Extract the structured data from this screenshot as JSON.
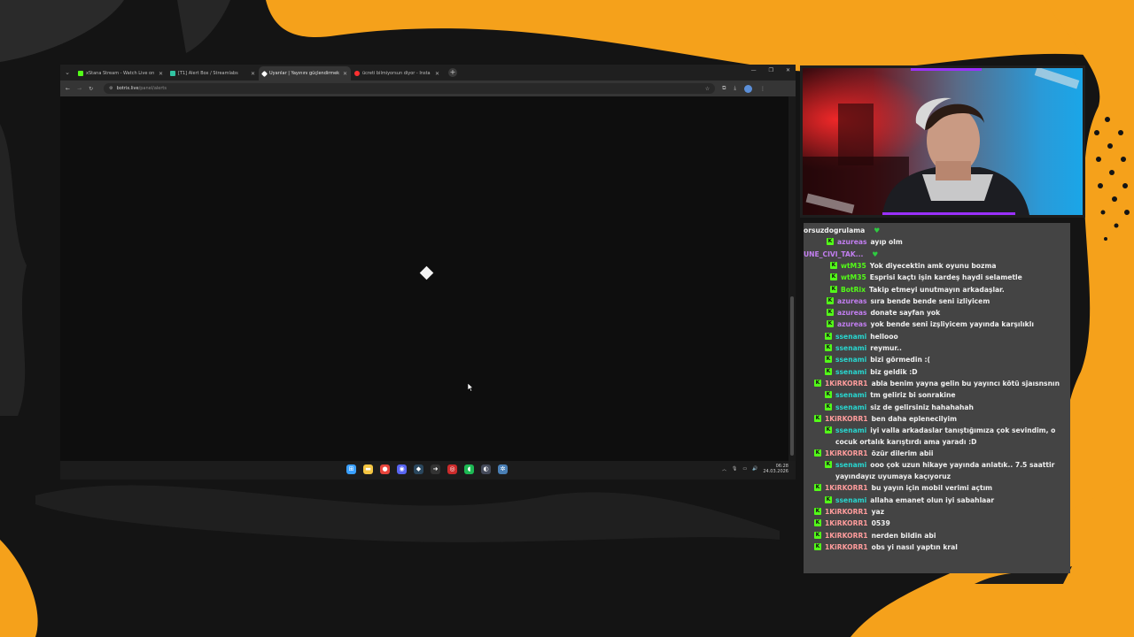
{
  "colors": {
    "background": "#141414",
    "accent_orange": "#f5a11b",
    "kick_green": "#53fc18",
    "webcam_accent": "#9b30ff",
    "chat_bg": "#444444"
  },
  "browser": {
    "tabs": [
      {
        "label": "xStana Stream - Watch Live on",
        "favicon": "kick-icon",
        "color": "#53fc18",
        "active": false
      },
      {
        "label": "[T1] Alert Box / Streamlabs",
        "favicon": "streamlabs-icon",
        "color": "#31c3a2",
        "active": false
      },
      {
        "label": "Uyarılar | Yayınını güçlendirmek",
        "favicon": "botrix-icon",
        "color": "#ffffff",
        "active": true
      },
      {
        "label": "ücreti bilmiyorsun diyor - İnsta",
        "favicon": "youtube-icon",
        "color": "#ff3030",
        "active": false
      }
    ],
    "new_tab_label": "+",
    "url_host": "botrix.live",
    "url_path": "/panel/alerts",
    "taskbar": {
      "time": "06:28",
      "date": "24.03.2026",
      "apps": [
        {
          "icon": "windows-start-icon",
          "color": "#3aa0ff",
          "glyph": "⊞"
        },
        {
          "icon": "file-explorer-icon",
          "color": "#f4c542",
          "glyph": "▬"
        },
        {
          "icon": "chrome-icon",
          "color": "#e8453c",
          "glyph": "●"
        },
        {
          "icon": "discord-icon",
          "color": "#5865f2",
          "glyph": "◉"
        },
        {
          "icon": "steam-icon",
          "color": "#2a475e",
          "glyph": "◆"
        },
        {
          "icon": "arrow-app-icon",
          "color": "#333333",
          "glyph": "➜"
        },
        {
          "icon": "record-icon",
          "color": "#cc2b2b",
          "glyph": "◎"
        },
        {
          "icon": "spotify-icon",
          "color": "#1db954",
          "glyph": "◖"
        },
        {
          "icon": "obs-icon",
          "color": "#444a5a",
          "glyph": "◐"
        },
        {
          "icon": "settings-app-icon",
          "color": "#4a7fb5",
          "glyph": "✲"
        }
      ]
    }
  },
  "chat": {
    "messages": [
      {
        "user": "orsuzdogrulama",
        "user_color": "#f0f0f0",
        "text": "",
        "heart": true,
        "badge": false,
        "indent": 0
      },
      {
        "user": "azureas",
        "user_color": "#c27ef0",
        "text": "ayıp olm",
        "heart": false,
        "badge": true,
        "indent": 26
      },
      {
        "user": "UNE_CIVI_TAK...",
        "user_color": "#c27ef0",
        "text": "",
        "heart": true,
        "badge": false,
        "indent": 0
      },
      {
        "user": "wtM35",
        "user_color": "#53fc18",
        "text": "Yok diyecektin amk oyunu bozma",
        "heart": false,
        "badge": true,
        "indent": 30
      },
      {
        "user": "wtM35",
        "user_color": "#53fc18",
        "text": "Esprisi kaçtı işin kardeş haydi selametle",
        "heart": false,
        "badge": true,
        "indent": 30
      },
      {
        "user": "BotRix",
        "user_color": "#53fc18",
        "text": "Takip etmeyi unutmayın arkadaşlar.",
        "heart": false,
        "badge": true,
        "indent": 30
      },
      {
        "user": "azureas",
        "user_color": "#c27ef0",
        "text": "sıra bende bende seni izliyicem",
        "heart": false,
        "badge": true,
        "indent": 26
      },
      {
        "user": "azureas",
        "user_color": "#c27ef0",
        "text": "donate sayfan yok",
        "heart": false,
        "badge": true,
        "indent": 26
      },
      {
        "user": "azureas",
        "user_color": "#c27ef0",
        "text": "yok bende seni izşliyicem yayında karşılıklı",
        "heart": false,
        "badge": true,
        "indent": 26
      },
      {
        "user": "ssenami",
        "user_color": "#28d7d0",
        "text": "hellooo",
        "heart": false,
        "badge": true,
        "indent": 24
      },
      {
        "user": "ssenami",
        "user_color": "#28d7d0",
        "text": "reymur..",
        "heart": false,
        "badge": true,
        "indent": 24
      },
      {
        "user": "ssenami",
        "user_color": "#28d7d0",
        "text": "bizi görmedin :(",
        "heart": false,
        "badge": true,
        "indent": 24
      },
      {
        "user": "ssenami",
        "user_color": "#28d7d0",
        "text": "biz geldik :D",
        "heart": false,
        "badge": true,
        "indent": 24
      },
      {
        "user": "1KiRKORR1",
        "user_color": "#ff9c9c",
        "text": "abla benim yayna gelin bu yayıncı kötü sjaısnsnın",
        "heart": false,
        "badge": true,
        "indent": 12
      },
      {
        "user": "ssenami",
        "user_color": "#28d7d0",
        "text": "tm geliriz bi sonrakine",
        "heart": false,
        "badge": true,
        "indent": 24
      },
      {
        "user": "ssenami",
        "user_color": "#28d7d0",
        "text": "siz de gelirsiniz hahahahah",
        "heart": false,
        "badge": true,
        "indent": 24
      },
      {
        "user": "1KiRKORR1",
        "user_color": "#ff9c9c",
        "text": "ben daha eplenecilyim",
        "heart": false,
        "badge": true,
        "indent": 12
      },
      {
        "user": "ssenami",
        "user_color": "#28d7d0",
        "text": "iyi valla arkadaslar tanıştığımıza çok sevindim, o",
        "cont": "cocuk ortalık karıştırdı ama yaradı :D",
        "heart": false,
        "badge": true,
        "indent": 24
      },
      {
        "user": "1KiRKORR1",
        "user_color": "#ff9c9c",
        "text": "özür dilerim abii",
        "heart": false,
        "badge": true,
        "indent": 12
      },
      {
        "user": "ssenami",
        "user_color": "#28d7d0",
        "text": "ooo çok uzun hikaye yayında anlatık.. 7.5 saattir",
        "cont": "yayındayız uyumaya kaçıyoruz",
        "heart": false,
        "badge": true,
        "indent": 24
      },
      {
        "user": "1KiRKORR1",
        "user_color": "#ff9c9c",
        "text": "bu yayın için mobil verimi açtım",
        "heart": false,
        "badge": true,
        "indent": 12
      },
      {
        "user": "ssenami",
        "user_color": "#28d7d0",
        "text": "allaha emanet olun iyi sabahlaar",
        "heart": false,
        "badge": true,
        "indent": 24
      },
      {
        "user": "1KiRKORR1",
        "user_color": "#ff9c9c",
        "text": "yaz",
        "heart": false,
        "badge": true,
        "indent": 12
      },
      {
        "user": "1KiRKORR1",
        "user_color": "#ff9c9c",
        "text": "0539",
        "heart": false,
        "badge": true,
        "indent": 12
      },
      {
        "user": "1KiRKORR1",
        "user_color": "#ff9c9c",
        "text": "nerden bildin abi",
        "heart": false,
        "badge": true,
        "indent": 12
      },
      {
        "user": "1KiRKORR1",
        "user_color": "#ff9c9c",
        "text": "obs yi nasıl yaptın kral",
        "heart": false,
        "badge": true,
        "indent": 12
      }
    ]
  }
}
